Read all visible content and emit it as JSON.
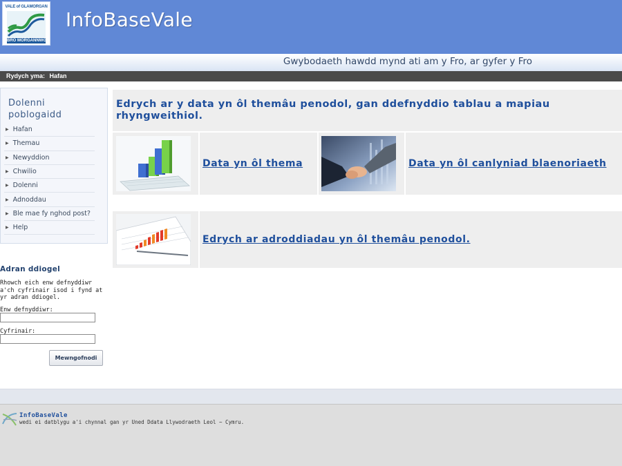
{
  "header": {
    "logo_top": "VALE of GLAMORGAN",
    "logo_bottom": "BRO MORGANNWG",
    "title": "InfoBaseVale",
    "tagline": "Gwybodaeth hawdd mynd ati am y Fro, ar gyfer y Fro"
  },
  "breadcrumb": {
    "label": "Rydych yma:",
    "current": "Hafan"
  },
  "sidebar": {
    "title": "Dolenni poblogaidd",
    "items": [
      {
        "label": "Hafan"
      },
      {
        "label": "Themau"
      },
      {
        "label": "Newyddion"
      },
      {
        "label": "Chwilio"
      },
      {
        "label": "Dolenni"
      },
      {
        "label": "Adnoddau"
      },
      {
        "label": "Ble mae fy nghod post?"
      },
      {
        "label": "Help"
      }
    ]
  },
  "login": {
    "title": "Adran ddiogel",
    "description": "Rhowch eich enw defnyddiwr a'ch cyfrinair isod i fynd at yr adran ddiogel.",
    "username_label": "Enw defnyddiwr:",
    "username_value": "",
    "password_label": "Cyfrinair:",
    "password_value": "",
    "button_label": "Mewngofnodi"
  },
  "main": {
    "heading": "Edrych ar y data yn ôl themâu penodol, gan ddefnyddio tablau a mapiau rhyngweithiol.",
    "link_theme": "Data yn ôl thema",
    "link_priority": "Data yn ôl canlyniad blaenoriaeth",
    "link_reports": "Edrych ar adroddiadau yn ôl themâu penodol."
  },
  "footer": {
    "name": "InfoBaseVale",
    "text": "wedi ei datblygu a'i chynnal gan yr Uned Ddata Llywodraeth Leol ~ Cymru."
  },
  "colors": {
    "header_bg": "#6088d6",
    "link": "#1f4f9c",
    "breadcrumb_bg": "#4a4a4a"
  }
}
